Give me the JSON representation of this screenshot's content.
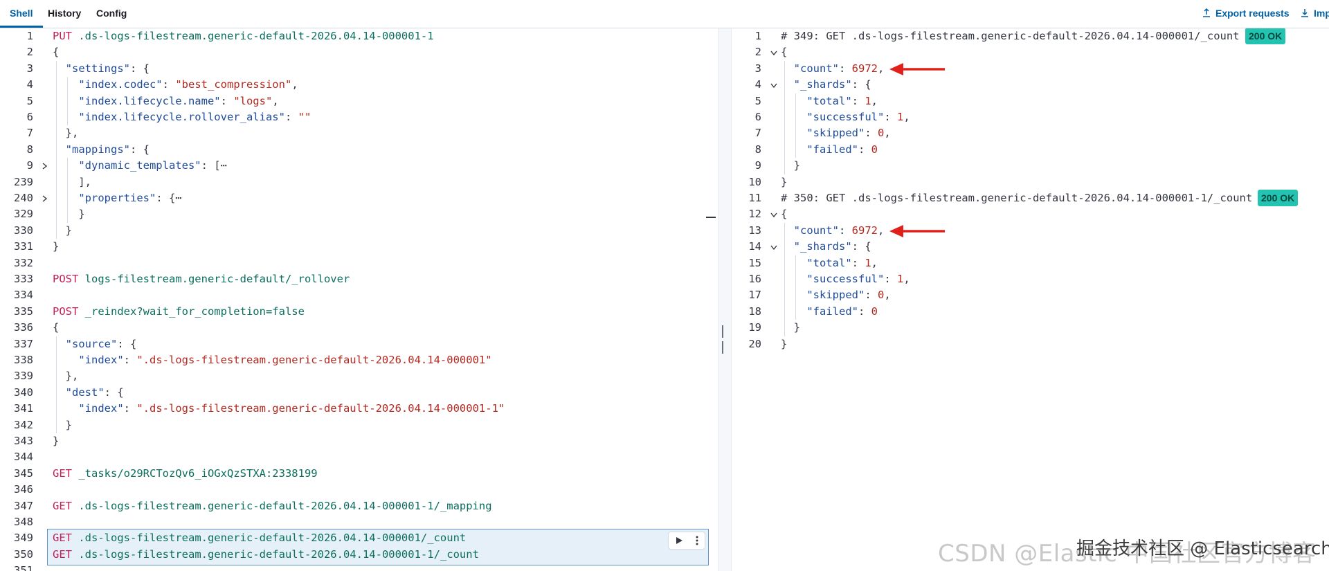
{
  "tabs": [
    {
      "label": "Shell",
      "active": true
    },
    {
      "label": "History",
      "active": false
    },
    {
      "label": "Config",
      "active": false
    }
  ],
  "top_actions": {
    "export": "Export requests",
    "import": "Imp"
  },
  "request_lines": [
    {
      "num": "1",
      "fold": "",
      "tokens": [
        [
          "m",
          "PUT"
        ],
        [
          "p",
          " "
        ],
        [
          "u",
          ".ds-logs-filestream.generic-default-2026.04.14-000001-1"
        ]
      ]
    },
    {
      "num": "2",
      "fold": "",
      "tokens": [
        [
          "p",
          "{"
        ]
      ]
    },
    {
      "num": "3",
      "fold": "",
      "tokens": [
        [
          "p",
          "  "
        ],
        [
          "k",
          "\"settings\""
        ],
        [
          "p",
          ": {"
        ]
      ]
    },
    {
      "num": "4",
      "fold": "",
      "tokens": [
        [
          "p",
          "    "
        ],
        [
          "k",
          "\"index.codec\""
        ],
        [
          "p",
          ": "
        ],
        [
          "s",
          "\"best_compression\""
        ],
        [
          "p",
          ","
        ]
      ]
    },
    {
      "num": "5",
      "fold": "",
      "tokens": [
        [
          "p",
          "    "
        ],
        [
          "k",
          "\"index.lifecycle.name\""
        ],
        [
          "p",
          ": "
        ],
        [
          "s",
          "\"logs\""
        ],
        [
          "p",
          ","
        ]
      ]
    },
    {
      "num": "6",
      "fold": "",
      "tokens": [
        [
          "p",
          "    "
        ],
        [
          "k",
          "\"index.lifecycle.rollover_alias\""
        ],
        [
          "p",
          ": "
        ],
        [
          "s",
          "\"\""
        ]
      ]
    },
    {
      "num": "7",
      "fold": "",
      "tokens": [
        [
          "p",
          "  },"
        ]
      ]
    },
    {
      "num": "8",
      "fold": "",
      "tokens": [
        [
          "p",
          "  "
        ],
        [
          "k",
          "\"mappings\""
        ],
        [
          "p",
          ": {"
        ]
      ]
    },
    {
      "num": "9",
      "fold": "right",
      "tokens": [
        [
          "p",
          "    "
        ],
        [
          "k",
          "\"dynamic_templates\""
        ],
        [
          "p",
          ": [⋯"
        ]
      ]
    },
    {
      "num": "239",
      "fold": "",
      "tokens": [
        [
          "p",
          "    ],"
        ]
      ]
    },
    {
      "num": "240",
      "fold": "right",
      "tokens": [
        [
          "p",
          "    "
        ],
        [
          "k",
          "\"properties\""
        ],
        [
          "p",
          ": {⋯"
        ]
      ]
    },
    {
      "num": "329",
      "fold": "",
      "tokens": [
        [
          "p",
          "    }"
        ]
      ]
    },
    {
      "num": "330",
      "fold": "",
      "tokens": [
        [
          "p",
          "  }"
        ]
      ]
    },
    {
      "num": "331",
      "fold": "",
      "tokens": [
        [
          "p",
          "}"
        ]
      ]
    },
    {
      "num": "332",
      "fold": "",
      "tokens": []
    },
    {
      "num": "333",
      "fold": "",
      "tokens": [
        [
          "m",
          "POST"
        ],
        [
          "p",
          " "
        ],
        [
          "u",
          "logs-filestream.generic-default/_rollover"
        ]
      ]
    },
    {
      "num": "334",
      "fold": "",
      "tokens": []
    },
    {
      "num": "335",
      "fold": "",
      "tokens": [
        [
          "m",
          "POST"
        ],
        [
          "p",
          " "
        ],
        [
          "u",
          "_reindex?wait_for_completion=false"
        ]
      ]
    },
    {
      "num": "336",
      "fold": "",
      "tokens": [
        [
          "p",
          "{"
        ]
      ]
    },
    {
      "num": "337",
      "fold": "",
      "tokens": [
        [
          "p",
          "  "
        ],
        [
          "k",
          "\"source\""
        ],
        [
          "p",
          ": {"
        ]
      ]
    },
    {
      "num": "338",
      "fold": "",
      "tokens": [
        [
          "p",
          "    "
        ],
        [
          "k",
          "\"index\""
        ],
        [
          "p",
          ": "
        ],
        [
          "s",
          "\".ds-logs-filestream.generic-default-2026.04.14-000001\""
        ]
      ]
    },
    {
      "num": "339",
      "fold": "",
      "tokens": [
        [
          "p",
          "  },"
        ]
      ]
    },
    {
      "num": "340",
      "fold": "",
      "tokens": [
        [
          "p",
          "  "
        ],
        [
          "k",
          "\"dest\""
        ],
        [
          "p",
          ": {"
        ]
      ]
    },
    {
      "num": "341",
      "fold": "",
      "tokens": [
        [
          "p",
          "    "
        ],
        [
          "k",
          "\"index\""
        ],
        [
          "p",
          ": "
        ],
        [
          "s",
          "\".ds-logs-filestream.generic-default-2026.04.14-000001-1\""
        ]
      ]
    },
    {
      "num": "342",
      "fold": "",
      "tokens": [
        [
          "p",
          "  }"
        ]
      ]
    },
    {
      "num": "343",
      "fold": "",
      "tokens": [
        [
          "p",
          "}"
        ]
      ]
    },
    {
      "num": "344",
      "fold": "",
      "tokens": []
    },
    {
      "num": "345",
      "fold": "",
      "tokens": [
        [
          "m",
          "GET"
        ],
        [
          "p",
          " "
        ],
        [
          "u",
          "_tasks/o29RCTozQv6_iOGxQzSTXA:2338199"
        ]
      ]
    },
    {
      "num": "346",
      "fold": "",
      "tokens": []
    },
    {
      "num": "347",
      "fold": "",
      "tokens": [
        [
          "m",
          "GET"
        ],
        [
          "p",
          " "
        ],
        [
          "u",
          ".ds-logs-filestream.generic-default-2026.04.14-000001-1/_mapping"
        ]
      ]
    },
    {
      "num": "348",
      "fold": "",
      "tokens": []
    },
    {
      "num": "349",
      "fold": "",
      "tokens": [
        [
          "m",
          "GET"
        ],
        [
          "p",
          " "
        ],
        [
          "u",
          ".ds-logs-filestream.generic-default-2026.04.14-000001/_count"
        ]
      ]
    },
    {
      "num": "350",
      "fold": "",
      "tokens": [
        [
          "m",
          "GET"
        ],
        [
          "p",
          " "
        ],
        [
          "u",
          ".ds-logs-filestream.generic-default-2026.04.14-000001-1/_count"
        ]
      ]
    },
    {
      "num": "351",
      "fold": "",
      "tokens": []
    }
  ],
  "response_lines": [
    {
      "num": "1",
      "fold": "",
      "tokens": [
        [
          "c",
          "# 349: GET .ds-logs-filestream.generic-default-2026.04.14-000001/_count"
        ]
      ],
      "status": "200 OK"
    },
    {
      "num": "2",
      "fold": "down",
      "tokens": [
        [
          "p",
          "{"
        ]
      ]
    },
    {
      "num": "3",
      "fold": "",
      "tokens": [
        [
          "p",
          "  "
        ],
        [
          "k",
          "\"count\""
        ],
        [
          "p",
          ": "
        ],
        [
          "n",
          "6972"
        ],
        [
          "p",
          ","
        ]
      ],
      "arrow": true
    },
    {
      "num": "4",
      "fold": "down",
      "tokens": [
        [
          "p",
          "  "
        ],
        [
          "k",
          "\"_shards\""
        ],
        [
          "p",
          ": {"
        ]
      ]
    },
    {
      "num": "5",
      "fold": "",
      "tokens": [
        [
          "p",
          "    "
        ],
        [
          "k",
          "\"total\""
        ],
        [
          "p",
          ": "
        ],
        [
          "n",
          "1"
        ],
        [
          "p",
          ","
        ]
      ]
    },
    {
      "num": "6",
      "fold": "",
      "tokens": [
        [
          "p",
          "    "
        ],
        [
          "k",
          "\"successful\""
        ],
        [
          "p",
          ": "
        ],
        [
          "n",
          "1"
        ],
        [
          "p",
          ","
        ]
      ]
    },
    {
      "num": "7",
      "fold": "",
      "tokens": [
        [
          "p",
          "    "
        ],
        [
          "k",
          "\"skipped\""
        ],
        [
          "p",
          ": "
        ],
        [
          "n",
          "0"
        ],
        [
          "p",
          ","
        ]
      ]
    },
    {
      "num": "8",
      "fold": "",
      "tokens": [
        [
          "p",
          "    "
        ],
        [
          "k",
          "\"failed\""
        ],
        [
          "p",
          ": "
        ],
        [
          "n",
          "0"
        ]
      ]
    },
    {
      "num": "9",
      "fold": "",
      "tokens": [
        [
          "p",
          "  }"
        ]
      ]
    },
    {
      "num": "10",
      "fold": "",
      "tokens": [
        [
          "p",
          "}"
        ]
      ]
    },
    {
      "num": "11",
      "fold": "",
      "tokens": [
        [
          "c",
          "# 350: GET .ds-logs-filestream.generic-default-2026.04.14-000001-1/_count"
        ]
      ],
      "status": "200 OK"
    },
    {
      "num": "12",
      "fold": "down",
      "tokens": [
        [
          "p",
          "{"
        ]
      ]
    },
    {
      "num": "13",
      "fold": "",
      "tokens": [
        [
          "p",
          "  "
        ],
        [
          "k",
          "\"count\""
        ],
        [
          "p",
          ": "
        ],
        [
          "n",
          "6972"
        ],
        [
          "p",
          ","
        ]
      ],
      "arrow": true
    },
    {
      "num": "14",
      "fold": "down",
      "tokens": [
        [
          "p",
          "  "
        ],
        [
          "k",
          "\"_shards\""
        ],
        [
          "p",
          ": {"
        ]
      ]
    },
    {
      "num": "15",
      "fold": "",
      "tokens": [
        [
          "p",
          "    "
        ],
        [
          "k",
          "\"total\""
        ],
        [
          "p",
          ": "
        ],
        [
          "n",
          "1"
        ],
        [
          "p",
          ","
        ]
      ]
    },
    {
      "num": "16",
      "fold": "",
      "tokens": [
        [
          "p",
          "    "
        ],
        [
          "k",
          "\"successful\""
        ],
        [
          "p",
          ": "
        ],
        [
          "n",
          "1"
        ],
        [
          "p",
          ","
        ]
      ]
    },
    {
      "num": "17",
      "fold": "",
      "tokens": [
        [
          "p",
          "    "
        ],
        [
          "k",
          "\"skipped\""
        ],
        [
          "p",
          ": "
        ],
        [
          "n",
          "0"
        ],
        [
          "p",
          ","
        ]
      ]
    },
    {
      "num": "18",
      "fold": "",
      "tokens": [
        [
          "p",
          "    "
        ],
        [
          "k",
          "\"failed\""
        ],
        [
          "p",
          ": "
        ],
        [
          "n",
          "0"
        ]
      ]
    },
    {
      "num": "19",
      "fold": "",
      "tokens": [
        [
          "p",
          "  }"
        ]
      ]
    },
    {
      "num": "20",
      "fold": "",
      "tokens": [
        [
          "p",
          "}"
        ]
      ]
    }
  ],
  "watermark": "CSDN @Elastic 中国社区官方博客",
  "watermark_overlay": "掘金技术社区 @ Elasticsearch",
  "colors": {
    "accent": "#0061a6",
    "status_ok": "#24c2b0",
    "arrow": "#e0201b",
    "method": "#c41e5a",
    "url": "#0b6e5f",
    "key": "#1f4b99",
    "string": "#b5281f"
  },
  "icons": {
    "export": "export-icon",
    "import": "import-icon",
    "play": "play-icon",
    "more": "more-vertical-icon"
  }
}
